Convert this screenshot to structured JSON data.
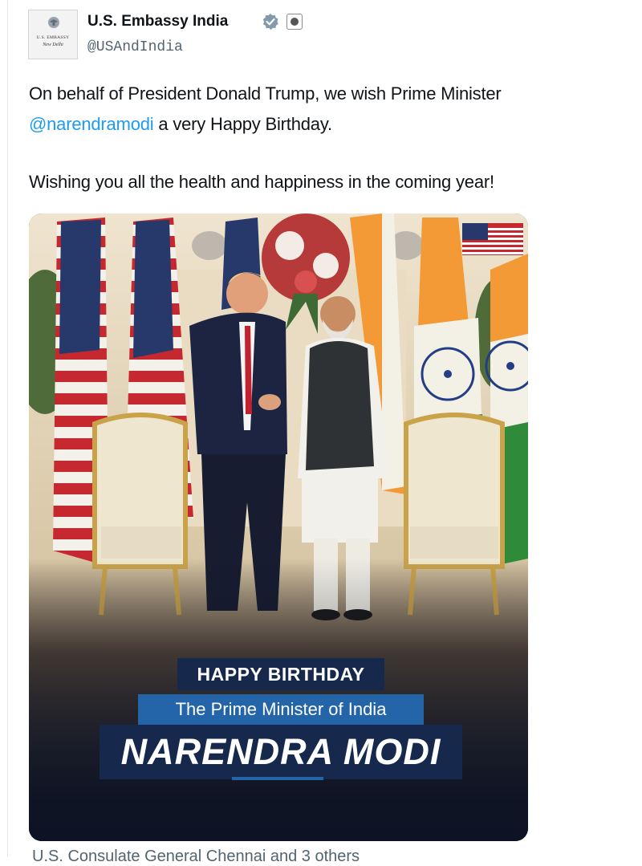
{
  "account": {
    "name": "U.S. Embassy India",
    "handle": "@USAndIndia",
    "avatar_line1": "U.S. EMBASSY",
    "avatar_line2": "New Delhi",
    "verified_icon": "verified-badge-icon",
    "affiliation_icon": "government-seal-icon"
  },
  "tweet": {
    "line1": "On behalf of President Donald Trump, we wish Prime Minister",
    "mention": "@narendramodi",
    "line2_rest": " a very Happy Birthday.",
    "line3": "Wishing you all the health and happiness in the coming year!"
  },
  "media": {
    "happy_birthday": "HAPPY BIRTHDAY",
    "subtitle": "The Prime Minister of India",
    "name": "NARENDRA MODI",
    "flag_icon": "us-flag-icon"
  },
  "footer": {
    "text": "U.S. Consulate General Chennai and 3 others"
  },
  "colors": {
    "link": "#1d9bf0",
    "verified": "#829aab",
    "banner_dark": "#16294c",
    "banner_blue": "#2464a9"
  }
}
